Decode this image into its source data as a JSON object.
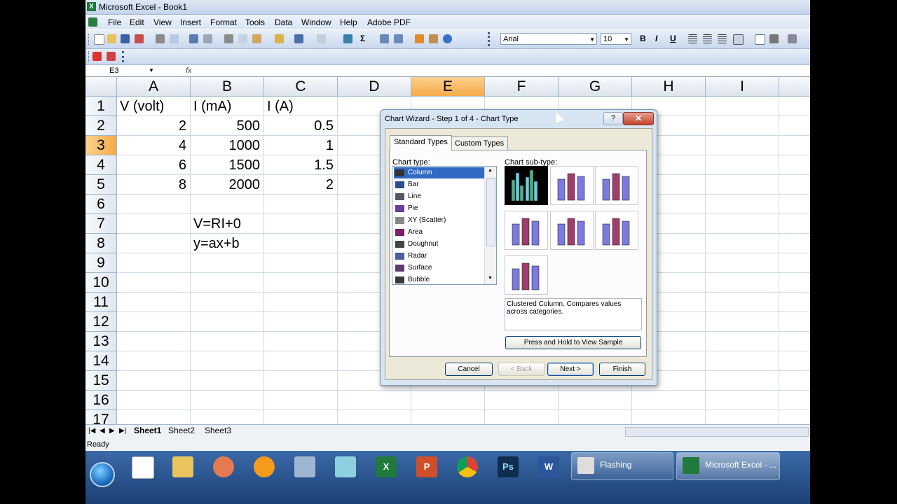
{
  "app": {
    "title": "Microsoft Excel - Book1"
  },
  "menu": [
    "File",
    "Edit",
    "View",
    "Insert",
    "Format",
    "Tools",
    "Data",
    "Window",
    "Help",
    "Adobe PDF"
  ],
  "toolbar": {
    "font": "Arial",
    "size": "10",
    "bold": "B",
    "italic": "I",
    "underline": "U",
    "sigma": "Σ"
  },
  "formula_bar": {
    "name_box": "E3",
    "fx": "fx",
    "content": ""
  },
  "grid": {
    "columns": [
      "A",
      "B",
      "C",
      "D",
      "E",
      "F",
      "G",
      "H",
      "I"
    ],
    "selected_column": "E",
    "rows": [
      "1",
      "2",
      "3",
      "4",
      "5",
      "6",
      "7",
      "8",
      "9",
      "10",
      "11",
      "12",
      "13",
      "14",
      "15",
      "16",
      "17"
    ],
    "selected_row": "3",
    "cells": {
      "A1": "V (volt)",
      "B1": "I (mA)",
      "C1": "I (A)",
      "A2": "2",
      "B2": "500",
      "C2": "0.5",
      "A3": "4",
      "B3": "1000",
      "C3": "1",
      "A4": "6",
      "B4": "1500",
      "C4": "1.5",
      "A5": "8",
      "B5": "2000",
      "C5": "2",
      "B7": "V=RI+0",
      "B8": "y=ax+b"
    }
  },
  "sheets": [
    "Sheet1",
    "Sheet2",
    "Sheet3"
  ],
  "active_sheet": "Sheet1",
  "status": "Ready",
  "dialog": {
    "title": "Chart Wizard - Step 1 of 4 - Chart Type",
    "help": "?",
    "close": "✕",
    "tabs": [
      "Standard Types",
      "Custom Types"
    ],
    "chart_type_label": "Chart type:",
    "chart_types": [
      "Column",
      "Bar",
      "Line",
      "Pie",
      "XY (Scatter)",
      "Area",
      "Doughnut",
      "Radar",
      "Surface",
      "Bubble"
    ],
    "selected_type": "Column",
    "subtype_label": "Chart sub-type:",
    "description": "Clustered Column. Compares values across categories.",
    "view_sample": "Press and Hold to View Sample",
    "buttons": {
      "cancel": "Cancel",
      "back": "< Back",
      "next": "Next >",
      "finish": "Finish"
    }
  },
  "taskbar": {
    "windows": [
      "Flashing",
      "Microsoft Excel - ..."
    ],
    "app_icons": [
      "graph-app-icon",
      "file-explorer-icon",
      "paint-icon",
      "media-player-icon",
      "calculator-icon",
      "ruler-app-icon",
      "excel-icon",
      "powerpoint-icon",
      "chrome-icon",
      "photoshop-icon",
      "word-icon"
    ]
  }
}
